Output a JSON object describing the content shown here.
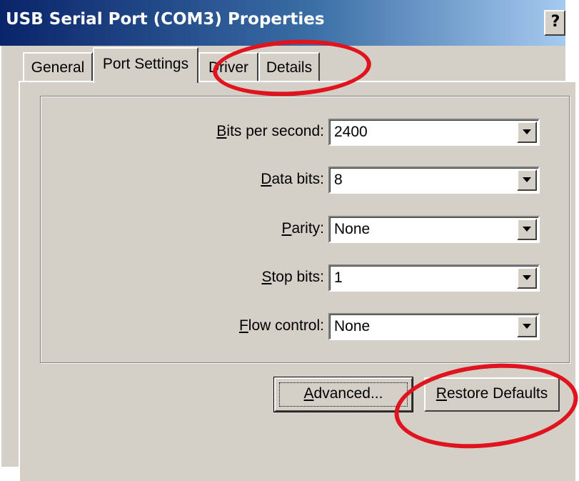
{
  "window": {
    "title": "USB Serial Port (COM3) Properties",
    "help_button": "?"
  },
  "tabs": [
    {
      "label": "General",
      "selected": false
    },
    {
      "label": "Port Settings",
      "selected": true
    },
    {
      "label": "Driver",
      "selected": false
    },
    {
      "label": "Details",
      "selected": false
    }
  ],
  "settings": {
    "bits_per_second": {
      "mnemonic": "B",
      "label_rest": "its per second:",
      "value": "2400"
    },
    "data_bits": {
      "mnemonic": "D",
      "label_rest": "ata bits:",
      "value": "8"
    },
    "parity": {
      "mnemonic": "P",
      "label_rest": "arity:",
      "value": "None"
    },
    "stop_bits": {
      "mnemonic": "S",
      "label_rest": "top bits:",
      "value": "1"
    },
    "flow_control": {
      "mnemonic": "F",
      "label_rest": "low control:",
      "value": "None"
    }
  },
  "buttons": {
    "advanced": {
      "mnemonic": "A",
      "label_rest": "dvanced..."
    },
    "restore": {
      "mnemonic": "R",
      "label_rest": "estore Defaults"
    }
  },
  "annotations": {
    "color": "#e0141e",
    "circled_items": [
      "Driver/Details tabs",
      "Restore Defaults button"
    ]
  }
}
